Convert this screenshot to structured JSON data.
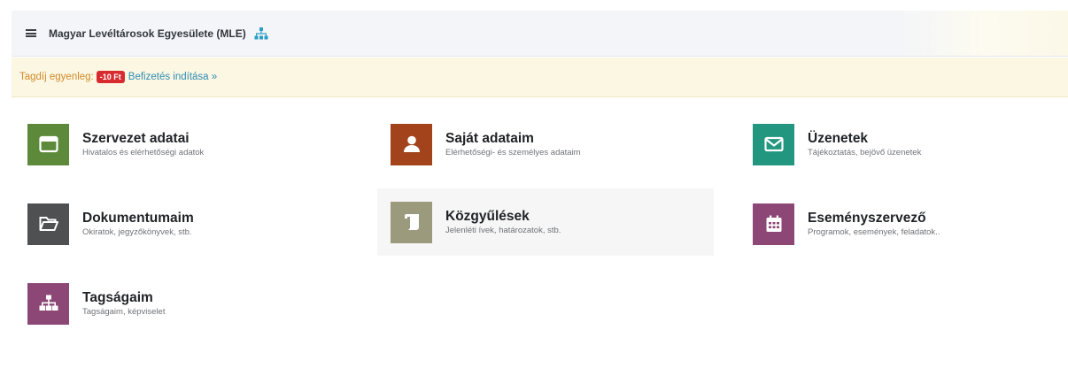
{
  "header": {
    "title": "Magyar Levéltárosok Egyesülete (MLE)",
    "menu_icon": "hamburger-icon",
    "org_icon": "sitemap-icon",
    "accent": "#2a9ec4"
  },
  "alert": {
    "label": "Tagdíj egyenleg:",
    "balance": "-10 Ft",
    "action": "Befizetés indítása »",
    "label_color": "#d08a2a",
    "badge_color": "#d82b30",
    "link_color": "#2d8db5"
  },
  "tiles": [
    {
      "title": "Szervezet adatai",
      "subtitle": "Hivatalos és elérhetőségi adatok",
      "icon": "window-icon",
      "color": "#5d8a3a"
    },
    {
      "title": "Saját adataim",
      "subtitle": "Elérhetőségi- és személyes adataim",
      "icon": "user-icon",
      "color": "#a2431b"
    },
    {
      "title": "Üzenetek",
      "subtitle": "Tájékoztatás, bejövő üzenetek",
      "icon": "envelope-icon",
      "color": "#22967f"
    },
    {
      "title": "Dokumentumaim",
      "subtitle": "Okiratok, jegyzőkönyvek, stb.",
      "icon": "folder-open-icon",
      "color": "#4f5052"
    },
    {
      "title": "Közgyűlések",
      "subtitle": "Jelenléti ívek, határozatok, stb.",
      "icon": "scroll-icon",
      "color": "#9c9a7c"
    },
    {
      "title": "Eseményszervező",
      "subtitle": "Programok, események, feladatok..",
      "icon": "calendar-icon",
      "color": "#8d4776"
    },
    {
      "title": "Tagságaim",
      "subtitle": "Tagságaim, képviselet",
      "icon": "sitemap-icon",
      "color": "#8d4776"
    }
  ]
}
